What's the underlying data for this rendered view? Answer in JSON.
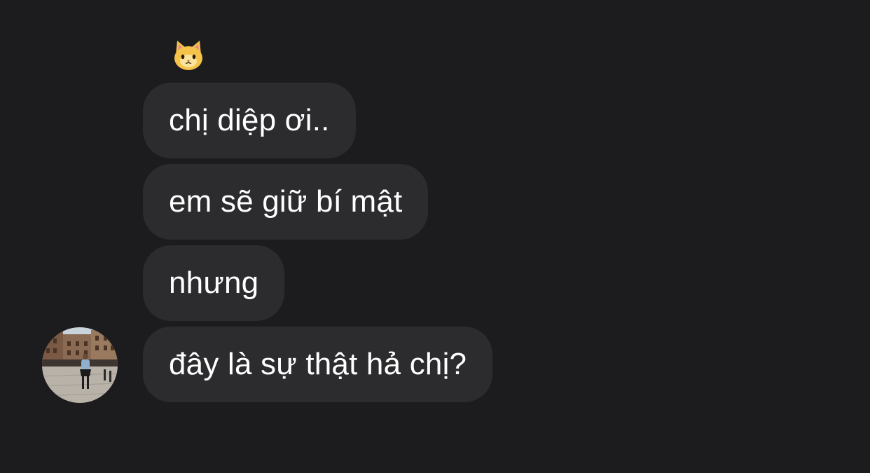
{
  "reaction": {
    "icon": "cat-face-icon"
  },
  "messages": [
    {
      "text": "chị diệp ơi.."
    },
    {
      "text": "em sẽ giữ bí mật"
    },
    {
      "text": "nhưng"
    },
    {
      "text": "đây là sự thật hả chị?"
    }
  ],
  "sender": {
    "avatar_icon": "avatar-photo"
  },
  "colors": {
    "background": "#1c1c1e",
    "bubble": "#2c2c2e",
    "text": "#ffffff"
  }
}
